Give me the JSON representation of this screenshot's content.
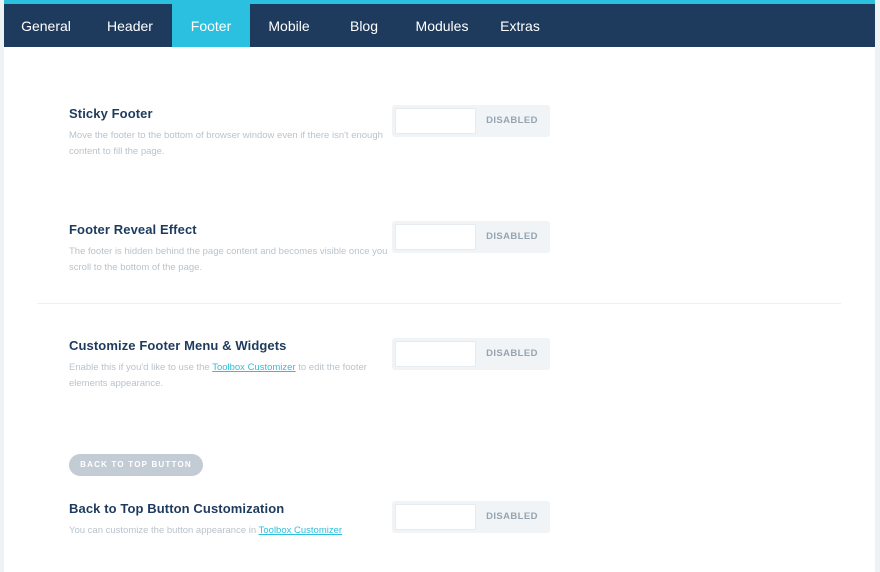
{
  "tabs": [
    {
      "label": "General"
    },
    {
      "label": "Header"
    },
    {
      "label": "Footer",
      "active": true
    },
    {
      "label": "Mobile"
    },
    {
      "label": "Blog"
    },
    {
      "label": "Modules"
    },
    {
      "label": "Extras"
    }
  ],
  "settings": [
    {
      "title": "Sticky Footer",
      "description": "Move the footer to the bottom of browser window even if there isn't enough content to fill the page.",
      "state": "DISABLED"
    },
    {
      "title": "Footer Reveal Effect",
      "description": "The footer is hidden behind the page content and becomes visible once you scroll to the bottom of the page.",
      "state": "DISABLED"
    },
    {
      "title": "Customize Footer Menu & Widgets",
      "description_before": "Enable this if you'd like to use the ",
      "description_link": "Toolbox Customizer",
      "description_after": " to edit the footer elements appearance.",
      "state": "DISABLED"
    },
    {
      "title": "Back to Top Button Customization",
      "description_before": "You can customize the button appearance in ",
      "description_link": "Toolbox Customizer",
      "description_after": "",
      "state": "DISABLED"
    }
  ],
  "section_label": "BACK TO TOP BUTTON",
  "colors": {
    "tabbar": "#1e3b5e",
    "accent": "#2bc0df",
    "title": "#1e3b5e",
    "muted": "#b9c3cc"
  }
}
